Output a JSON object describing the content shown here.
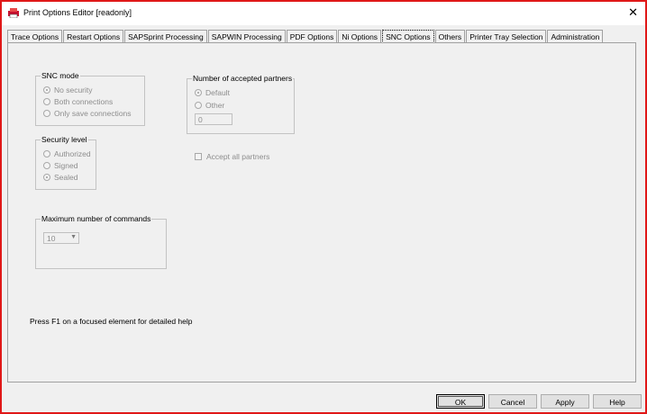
{
  "window": {
    "title": "Print Options Editor [readonly]"
  },
  "tabs": [
    {
      "label": "Trace Options"
    },
    {
      "label": "Restart Options"
    },
    {
      "label": "SAPSprint Processing"
    },
    {
      "label": "SAPWIN Processing"
    },
    {
      "label": "PDF Options"
    },
    {
      "label": "Ni Options"
    },
    {
      "label": "SNC Options"
    },
    {
      "label": "Others"
    },
    {
      "label": "Printer Tray Selection"
    },
    {
      "label": "Administration"
    }
  ],
  "active_tab": "SNC Options",
  "snc_mode": {
    "title": "SNC mode",
    "options": [
      {
        "label": "No security",
        "selected": true
      },
      {
        "label": "Both connections",
        "selected": false
      },
      {
        "label": "Only save connections",
        "selected": false
      }
    ]
  },
  "security_level": {
    "title": "Security level",
    "options": [
      {
        "label": "Authorized",
        "selected": false
      },
      {
        "label": "Signed",
        "selected": false
      },
      {
        "label": "Sealed",
        "selected": true
      }
    ]
  },
  "accepted_partners": {
    "title": "Number of accepted partners",
    "options": [
      {
        "label": "Default",
        "selected": true
      },
      {
        "label": "Other",
        "selected": false
      }
    ],
    "other_value": "0"
  },
  "accept_all_partners": {
    "label": "Accept all partners",
    "checked": false
  },
  "max_commands": {
    "title": "Maximum number of commands",
    "value": "10"
  },
  "hint": "Press F1 on a focused element for detailed help",
  "buttons": {
    "ok": "OK",
    "cancel": "Cancel",
    "apply": "Apply",
    "help": "Help"
  },
  "colors": {
    "frame": "#e01818",
    "disabled_text": "#8d8d8d",
    "panel_bg": "#f0f0f0"
  }
}
